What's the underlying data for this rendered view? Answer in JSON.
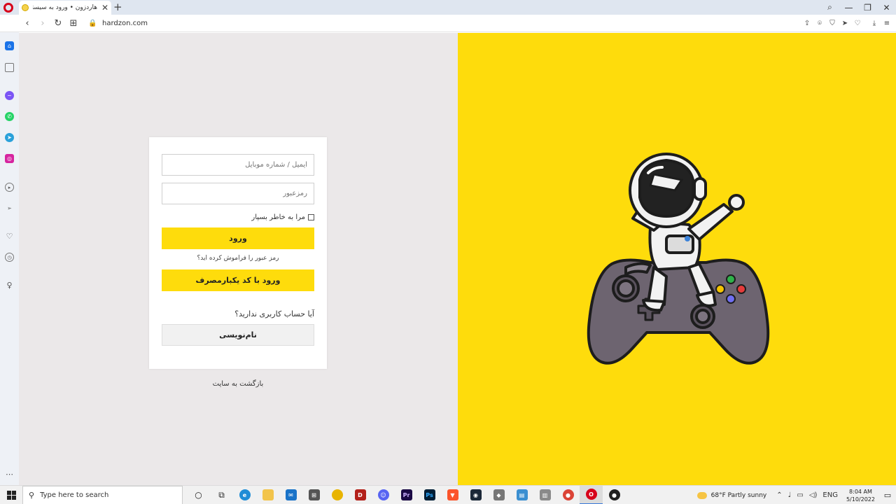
{
  "browser": {
    "tab": {
      "title": "هاردزون • ورود به سیستم",
      "close": "✕"
    },
    "new_tab": "+",
    "url": "hardzon.com",
    "window_controls": [
      "⌕",
      "—",
      "❐",
      "✕"
    ]
  },
  "sidebar": {
    "items": [
      {
        "name": "home",
        "icon": "home-icon",
        "color": "#1a73e8"
      },
      {
        "name": "speed-dial",
        "icon": "cube-icon",
        "color": "#555555"
      },
      {
        "name": "messenger",
        "icon": "messenger-icon",
        "color": "#7b55f5"
      },
      {
        "name": "whatsapp",
        "icon": "whatsapp-icon",
        "color": "#25d366"
      },
      {
        "name": "telegram",
        "icon": "telegram-icon",
        "color": "#2aa1da"
      },
      {
        "name": "instagram",
        "icon": "instagram-icon",
        "color": "#d6249f"
      },
      {
        "name": "player",
        "icon": "play-icon",
        "color": "#555555"
      },
      {
        "name": "send",
        "icon": "send-icon",
        "color": "#555555"
      },
      {
        "name": "bookmarks",
        "icon": "heart-icon",
        "color": "#555555"
      },
      {
        "name": "history",
        "icon": "clock-icon",
        "color": "#555555"
      },
      {
        "name": "tips",
        "icon": "lightbulb-icon",
        "color": "#555555"
      },
      {
        "name": "more",
        "icon": "more-icon",
        "color": "#555555"
      }
    ]
  },
  "login": {
    "email_placeholder": "ایمیل / شماره موبایل",
    "password_placeholder": "رمزعبور",
    "remember_label": "مرا به خاطر بسپار",
    "login_button": "ورود",
    "forgot_link": "رمز عبور را فراموش کرده اید؟",
    "otp_button": "ورود با کد یکبارمصرف",
    "no_account_text": "آیا حساب کاربری ندارید؟",
    "register_button": "نام‌نویسی",
    "back_link": "بازگشت به سایت"
  },
  "colors": {
    "accent_yellow": "#fedc0c",
    "left_bg": "#ebe8e9"
  },
  "taskbar": {
    "search_placeholder": "Type here to search",
    "weather": "68°F  Partly sunny",
    "language": "ENG",
    "time": "8:04 AM",
    "date": "5/10/2022"
  }
}
